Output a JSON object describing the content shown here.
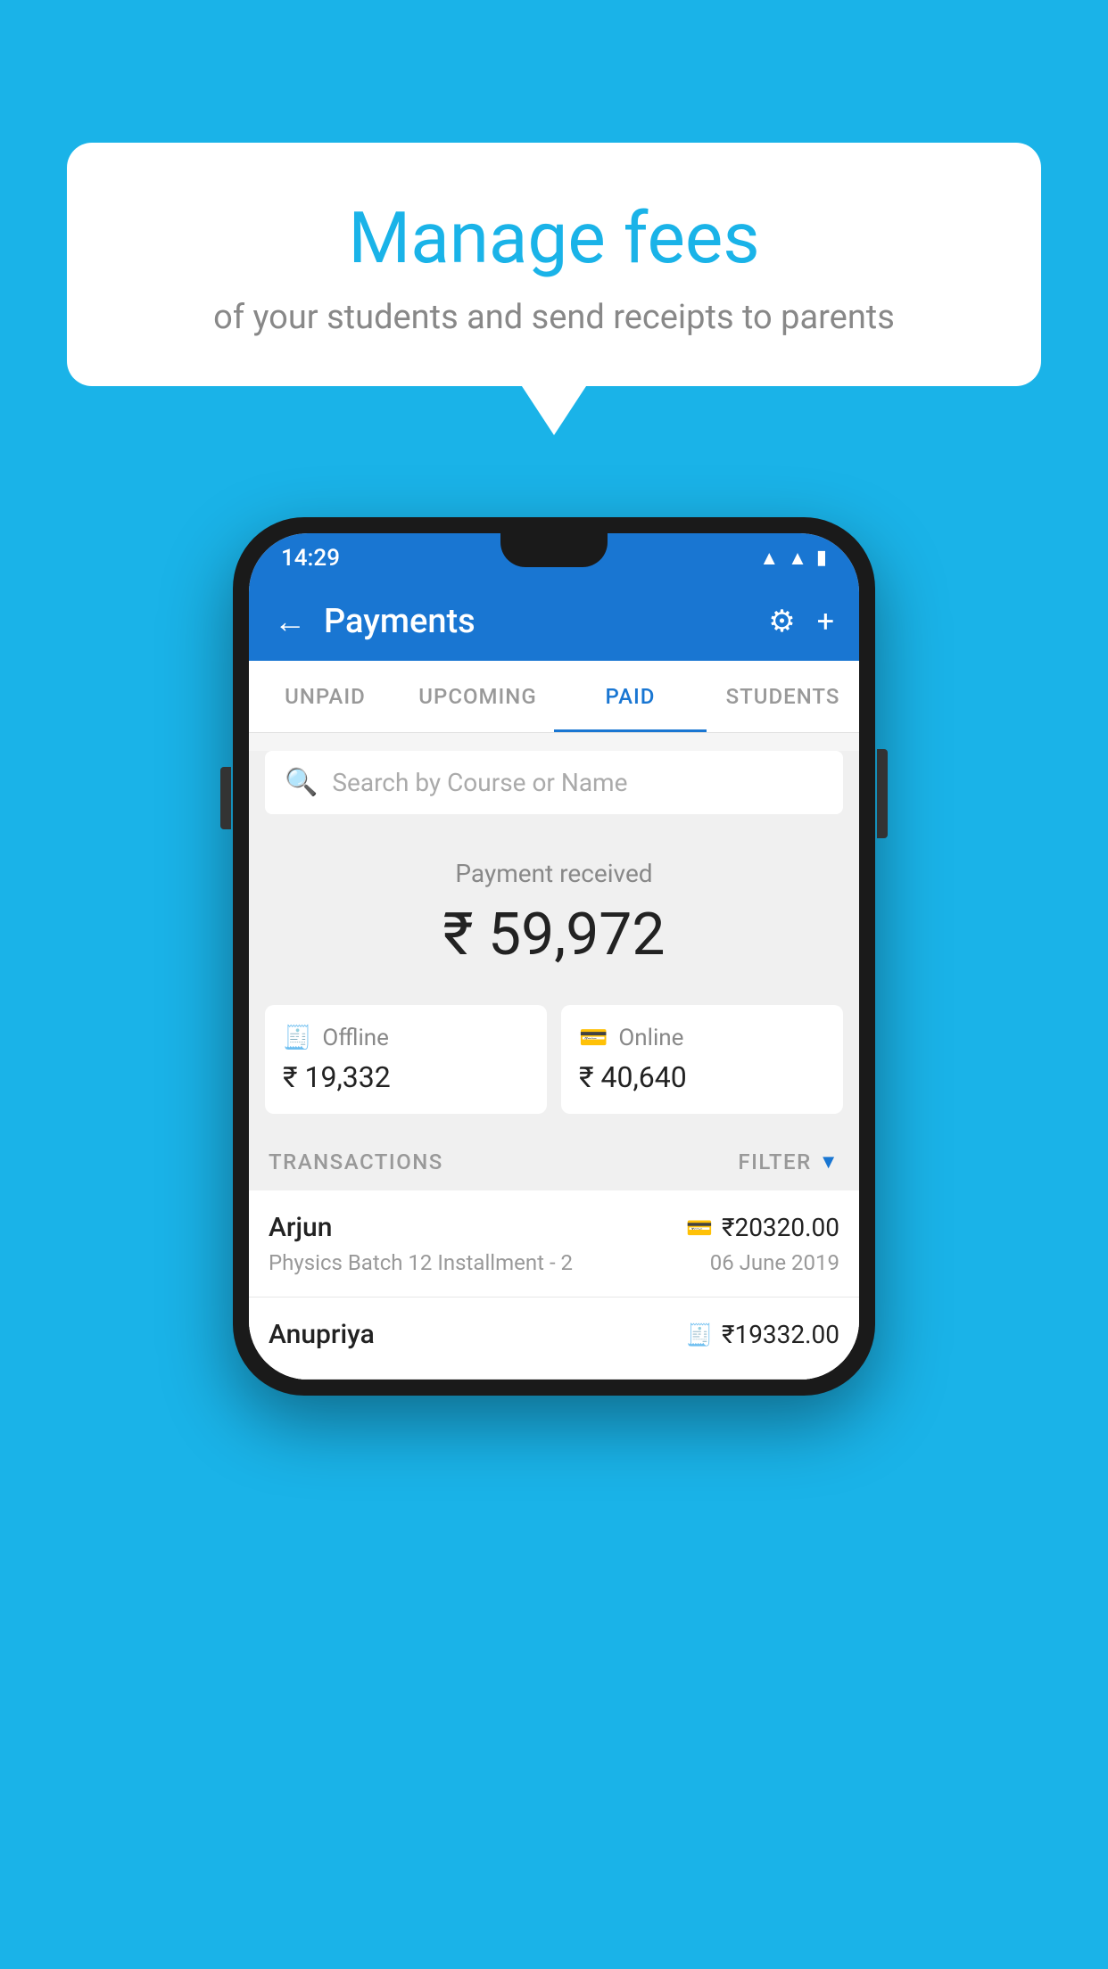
{
  "background_color": "#1ab3e8",
  "bubble": {
    "title": "Manage fees",
    "subtitle": "of your students and send receipts to parents"
  },
  "phone": {
    "status_bar": {
      "time": "14:29",
      "icons": [
        "wifi",
        "signal",
        "battery"
      ]
    },
    "app_bar": {
      "title": "Payments",
      "back_label": "←",
      "gear_label": "⚙",
      "plus_label": "+"
    },
    "tabs": [
      {
        "label": "UNPAID",
        "active": false
      },
      {
        "label": "UPCOMING",
        "active": false
      },
      {
        "label": "PAID",
        "active": true
      },
      {
        "label": "STUDENTS",
        "active": false
      }
    ],
    "search": {
      "placeholder": "Search by Course or Name"
    },
    "payment_received": {
      "label": "Payment received",
      "amount": "₹ 59,972"
    },
    "cards": [
      {
        "type": "Offline",
        "amount": "₹ 19,332",
        "icon": "💳"
      },
      {
        "type": "Online",
        "amount": "₹ 40,640",
        "icon": "💳"
      }
    ],
    "transactions_label": "TRANSACTIONS",
    "filter_label": "FILTER",
    "transactions": [
      {
        "name": "Arjun",
        "amount": "₹20320.00",
        "course": "Physics Batch 12 Installment - 2",
        "date": "06 June 2019",
        "payment_type": "online"
      },
      {
        "name": "Anupriya",
        "amount": "₹19332.00",
        "course": "",
        "date": "",
        "payment_type": "offline"
      }
    ]
  }
}
